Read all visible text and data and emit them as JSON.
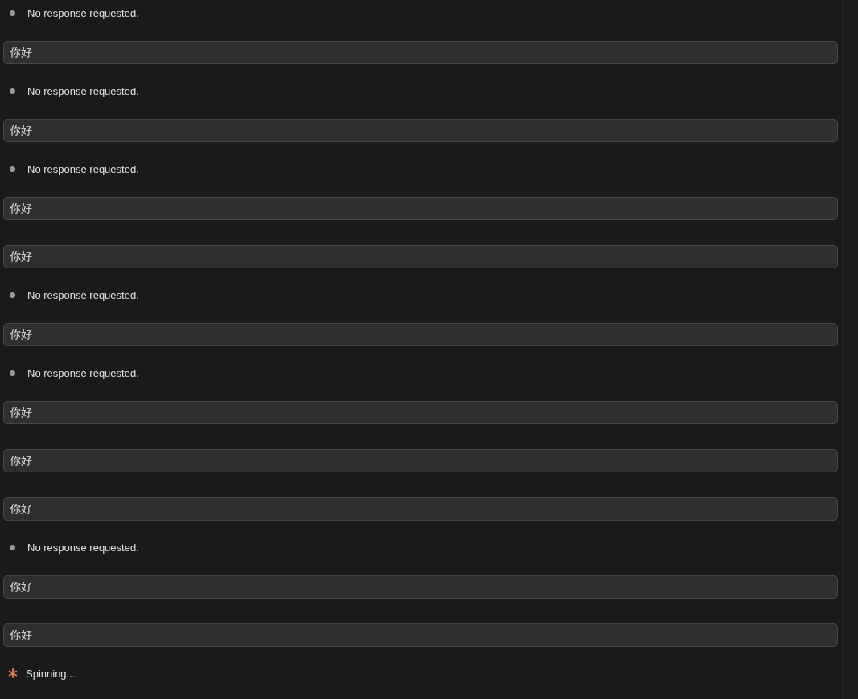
{
  "transcript": [
    {
      "kind": "response",
      "text": "No response requested."
    },
    {
      "kind": "message",
      "text": "你好"
    },
    {
      "kind": "response",
      "text": "No response requested."
    },
    {
      "kind": "message",
      "text": "你好"
    },
    {
      "kind": "response",
      "text": "No response requested."
    },
    {
      "kind": "message",
      "text": "你好"
    },
    {
      "kind": "message",
      "text": "你好"
    },
    {
      "kind": "response",
      "text": "No response requested."
    },
    {
      "kind": "message",
      "text": "你好"
    },
    {
      "kind": "response",
      "text": "No response requested."
    },
    {
      "kind": "message",
      "text": "你好"
    },
    {
      "kind": "message",
      "text": "你好"
    },
    {
      "kind": "message",
      "text": "你好"
    },
    {
      "kind": "response",
      "text": "No response requested."
    },
    {
      "kind": "message",
      "text": "你好"
    },
    {
      "kind": "message",
      "text": "你好"
    }
  ],
  "status": {
    "text": "Spinning..."
  }
}
